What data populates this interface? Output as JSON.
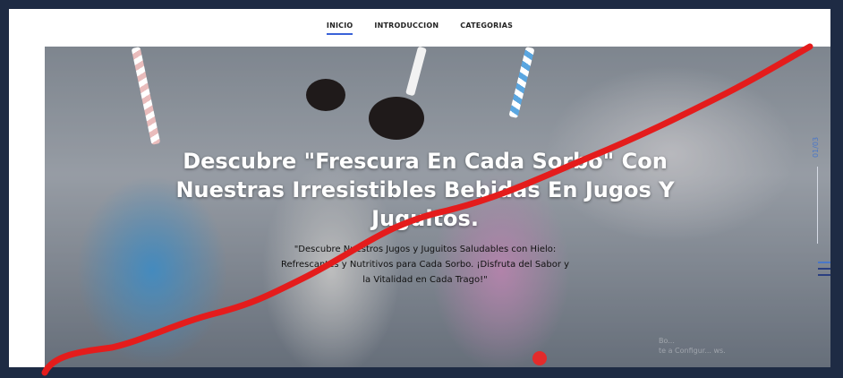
{
  "nav": {
    "items": [
      {
        "label": "INICIO",
        "active": true
      },
      {
        "label": "INTRODUCCION",
        "active": false
      },
      {
        "label": "CATEGORIAS",
        "active": false
      }
    ]
  },
  "hero": {
    "title": "Descubre \"Frescura En Cada Sorbo\" Con Nuestras Irresistibles Bebidas En Jugos Y Juguitos.",
    "description": "\"Descubre Nuestros Jugos y Juguitos Saludables con Hielo: Refrescantes y Nutritivos para Cada Sorbo. ¡Disfruta del Sabor y la Vitalidad en Cada Trago!\""
  },
  "slider": {
    "counter": "01/03"
  },
  "footnote": {
    "line1": "Bo...",
    "line2": "te a Configur... ws."
  },
  "colors": {
    "frame": "#1e2b44",
    "nav_active_underline": "#3a62d8",
    "scribble": "#e41c1c",
    "accent": "#4a77c8"
  },
  "icons": {
    "menu": "hamburger-menu-icon"
  }
}
